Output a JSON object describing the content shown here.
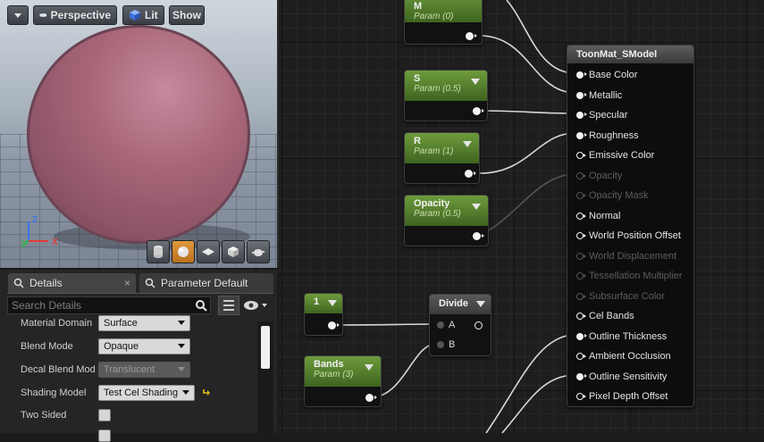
{
  "viewport": {
    "view_mode": "Perspective",
    "lighting": "Lit",
    "show": "Show",
    "axis": {
      "z": "Z",
      "y": "Y",
      "x": "X"
    },
    "colors": {
      "axis_x": "#e23b3b",
      "axis_y": "#34b34a",
      "axis_z": "#3a78e6"
    }
  },
  "details": {
    "tabs": [
      {
        "label": "Details",
        "close": "×"
      },
      {
        "label": "Parameter Default",
        "close": "×"
      }
    ],
    "search_placeholder": "Search Details",
    "properties": [
      {
        "label": "Material Domain",
        "value": "Surface"
      },
      {
        "label": "Blend Mode",
        "value": "Opaque"
      },
      {
        "label": "Decal Blend Mod",
        "value": "Translucent"
      },
      {
        "label": "Shading Model",
        "value": "Test Cel Shading"
      },
      {
        "label": "Two Sided",
        "value": ""
      }
    ]
  },
  "graph": {
    "param_nodes": [
      {
        "title": "M",
        "subtitle": "Param (0)"
      },
      {
        "title": "S",
        "subtitle": "Param (0.5)"
      },
      {
        "title": "R",
        "subtitle": "Param (1)"
      },
      {
        "title": "Opacity",
        "subtitle": "Param (0.5)"
      },
      {
        "title": "1",
        "subtitle": ""
      },
      {
        "title": "Bands",
        "subtitle": "Param (3)"
      }
    ],
    "divide_node": {
      "title": "Divide",
      "inputs": [
        "A",
        "B"
      ]
    },
    "material_node": {
      "title": "ToonMat_SModel",
      "inputs": [
        "Base Color",
        "Metallic",
        "Specular",
        "Roughness",
        "Emissive Color",
        "Opacity",
        "Opacity Mask",
        "Normal",
        "World Position Offset",
        "World Displacement",
        "Tessellation Multiplier",
        "Subsurface Color",
        "Cel Bands",
        "Outline Thickness",
        "Ambient Occlusion",
        "Outline Sensitivity",
        "Pixel Depth Offset"
      ]
    }
  }
}
